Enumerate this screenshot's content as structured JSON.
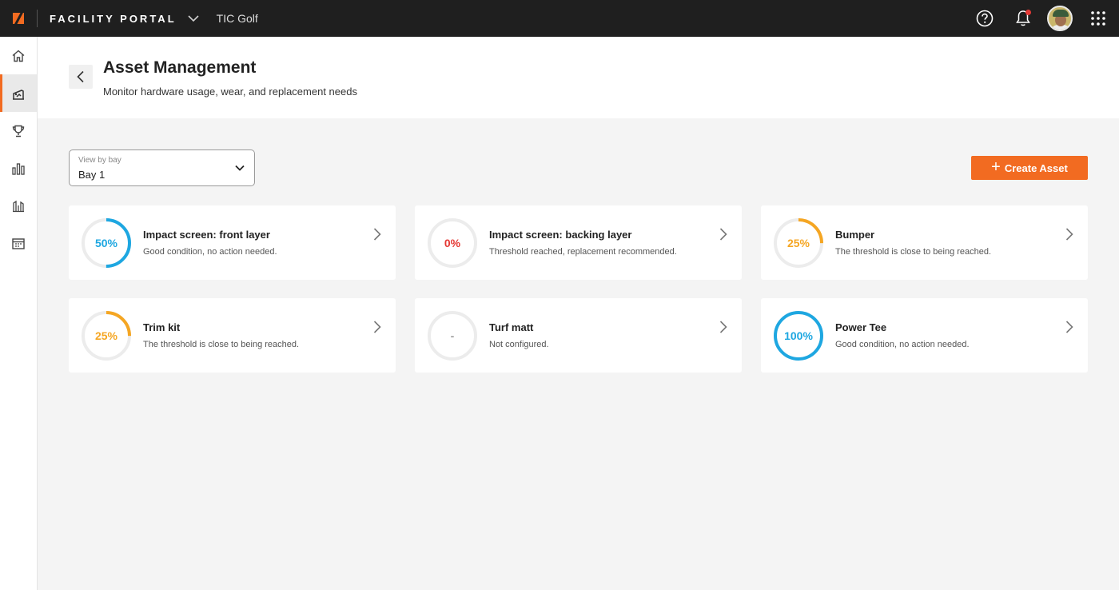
{
  "header": {
    "portal_title": "FACILITY PORTAL",
    "org_name": "TIC Golf"
  },
  "page": {
    "title": "Asset Management",
    "subtitle": "Monitor hardware usage, wear, and replacement needs"
  },
  "bay_select": {
    "label": "View by bay",
    "value": "Bay 1"
  },
  "create_button": {
    "label": "Create Asset"
  },
  "colors": {
    "accent": "#f26b21",
    "good": "#1ea7e1",
    "warning": "#f5a623",
    "critical": "#e53935",
    "neutral": "#9e9e9e",
    "track": "#ececec"
  },
  "sidebar": {
    "items": [
      {
        "icon": "home-icon",
        "active": false
      },
      {
        "icon": "hitting-bay-icon",
        "active": true
      },
      {
        "icon": "trophy-icon",
        "active": false
      },
      {
        "icon": "bar-chart-icon",
        "active": false
      },
      {
        "icon": "transfer-icon",
        "active": false
      },
      {
        "icon": "calendar-icon",
        "active": false
      }
    ]
  },
  "assets": [
    {
      "name": "Impact screen: front layer",
      "status": "Good condition, no action needed.",
      "percent_label": "50%",
      "progress": 50,
      "level": "good"
    },
    {
      "name": "Impact screen: backing layer",
      "status": "Threshold reached, replacement recommended.",
      "percent_label": "0%",
      "progress": 0,
      "level": "critical"
    },
    {
      "name": "Bumper",
      "status": "The threshold is close to being reached.",
      "percent_label": "25%",
      "progress": 25,
      "level": "warning"
    },
    {
      "name": "Trim kit",
      "status": "The threshold is close to being reached.",
      "percent_label": "25%",
      "progress": 25,
      "level": "warning"
    },
    {
      "name": "Turf matt",
      "status": "Not configured.",
      "percent_label": "-",
      "progress": 0,
      "level": "neutral"
    },
    {
      "name": "Power Tee",
      "status": "Good condition, no action needed.",
      "percent_label": "100%",
      "progress": 100,
      "level": "good"
    }
  ]
}
